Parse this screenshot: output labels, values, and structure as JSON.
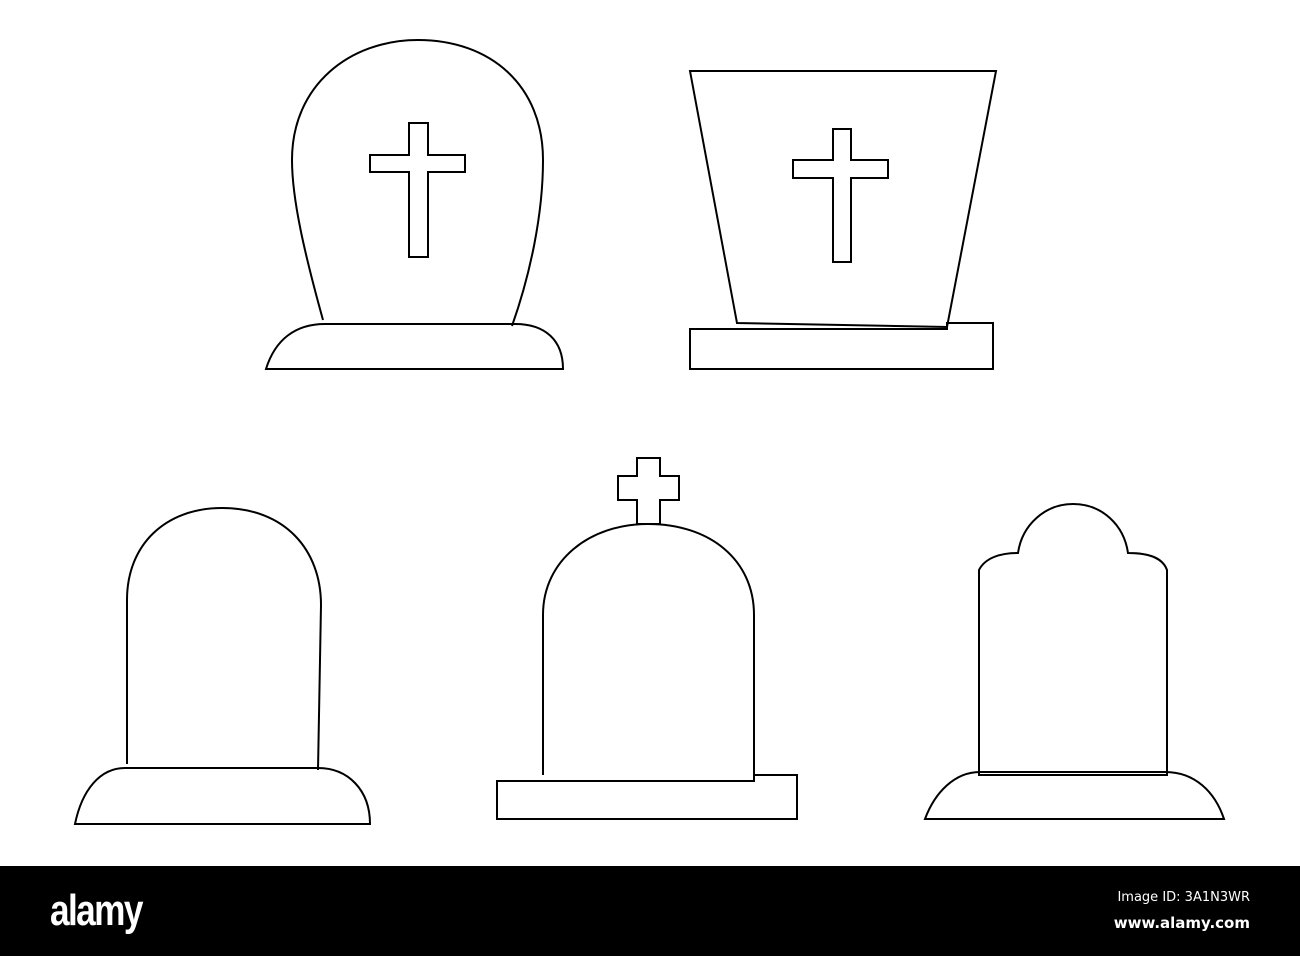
{
  "watermark": {
    "logo": "alamy",
    "image_id": "Image ID: 3A1N3WR",
    "url": "www.alamy.com"
  },
  "colors": {
    "stroke": "#000000",
    "background": "#ffffff",
    "bar": "#000000"
  }
}
